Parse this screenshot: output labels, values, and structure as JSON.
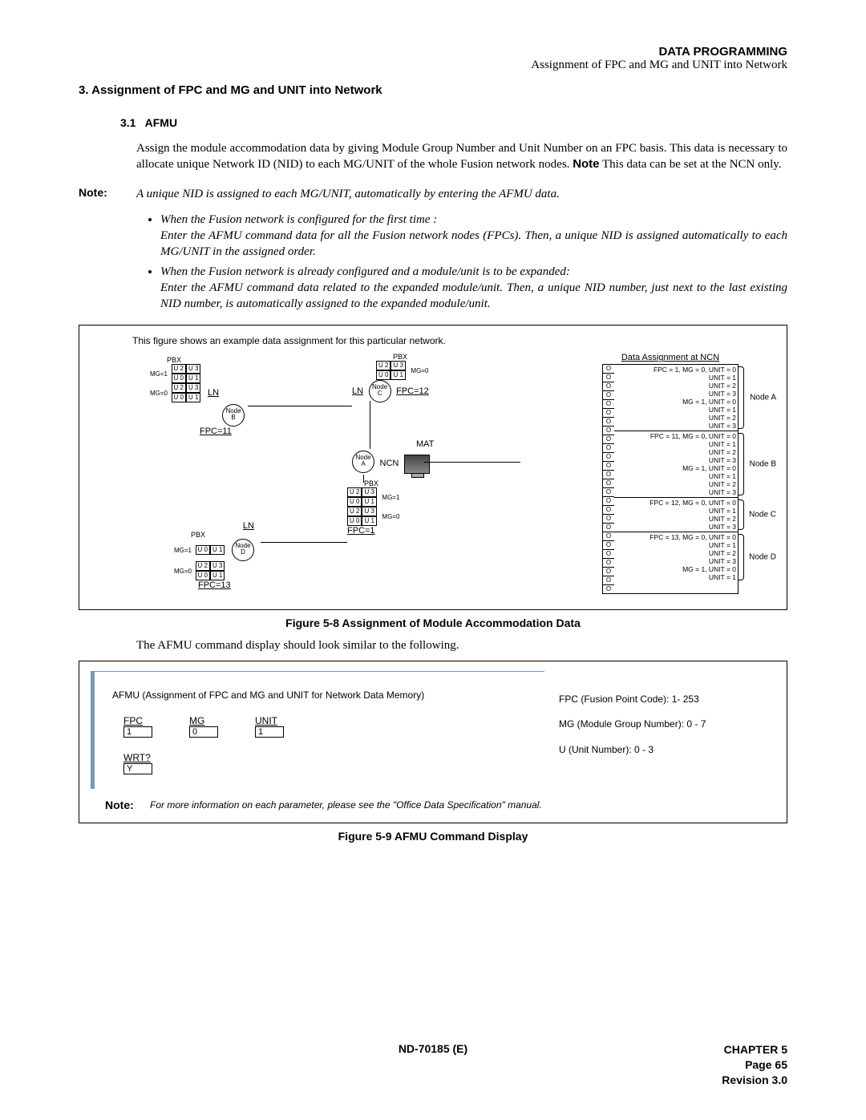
{
  "header": {
    "title": "DATA PROGRAMMING",
    "subtitle": "Assignment of FPC and MG and UNIT into Network"
  },
  "section": {
    "num_title": "3.   Assignment of FPC and MG and UNIT into Network",
    "sub_num": "3.1",
    "sub_title": "AFMU",
    "para1_a": "Assign the module accommodation data by giving Module Group Number and Unit Number on an FPC basis. This data is necessary to allocate unique Network ID (NID) to each MG/UNIT of the whole Fusion network nodes. ",
    "para1_note_lbl": "Note",
    "para1_b": " This data can be set at the NCN only."
  },
  "note1": {
    "label": "Note:",
    "text": "A unique NID is assigned to each MG/UNIT, automatically by entering the AFMU data."
  },
  "bullets": {
    "b1": "When the Fusion network is configured for the first time :",
    "b1b": "Enter the AFMU command data for all the Fusion network nodes (FPCs). Then, a unique NID is assigned automatically to each MG/UNIT in the assigned order.",
    "b2": "When the Fusion network is already configured and a module/unit is to be expanded:",
    "b2b": "Enter the AFMU command data related to the expanded module/unit. Then, a unique NID number, just next to the last existing NID number, is automatically assigned to the expanded module/unit."
  },
  "fig58": {
    "intro": "This figure shows an example data assignment for this particular network.",
    "PBX": "PBX",
    "LN": "LN",
    "MG1": "MG=1",
    "MG0": "MG=0",
    "cells": {
      "u0": "U 0",
      "u1": "U 1",
      "u2": "U 2",
      "u3": "U 3"
    },
    "fpc11": "FPC=11",
    "fpc12": "FPC=12",
    "fpc13": "FPC=13",
    "fpc1": "FPC=1",
    "nodeA_top": "Node",
    "nodeA_bot": "A",
    "nodeB_top": "Node",
    "nodeB_bot": "B",
    "nodeC_top": "Node",
    "nodeC_bot": "C",
    "nodeD_top": "Node",
    "nodeD_bot": "D",
    "NCN": "NCN",
    "MAT": "MAT",
    "da_title": "Data Assignment at NCN",
    "marker": "O",
    "blocks": [
      {
        "node": "Node A",
        "lines": [
          "FPC = 1,   MG = 0, UNIT = 0",
          "UNIT = 1",
          "UNIT = 2",
          "UNIT = 3",
          "MG = 1, UNIT = 0",
          "UNIT = 1",
          "UNIT = 2",
          "UNIT = 3"
        ]
      },
      {
        "node": "Node B",
        "lines": [
          "FPC = 11,  MG = 0, UNIT = 0",
          "UNIT = 1",
          "UNIT = 2",
          "UNIT = 3",
          "MG = 1, UNIT = 0",
          "UNIT = 1",
          "UNIT = 2",
          "UNIT = 3"
        ]
      },
      {
        "node": "Node C",
        "lines": [
          "FPC = 12,  MG = 0, UNIT = 0",
          "UNIT = 1",
          "UNIT = 2",
          "UNIT = 3"
        ]
      },
      {
        "node": "Node D",
        "lines": [
          "FPC = 13,  MG = 0, UNIT = 0",
          "UNIT = 1",
          "UNIT = 2",
          "UNIT = 3",
          "MG = 1, UNIT = 0",
          "UNIT = 1"
        ]
      }
    ],
    "caption": "Figure 5-8   Assignment of Module Accommodation Data"
  },
  "post_fig_text": "The AFMU command display should look similar to the following.",
  "fig59": {
    "title": "AFMU (Assignment of FPC and MG and UNIT for Network Data Memory)",
    "fields": {
      "fpc_l": "FPC",
      "fpc_v": "1",
      "mg_l": "MG",
      "mg_v": "0",
      "unit_l": "UNIT",
      "unit_v": "1",
      "wrt_l": "WRT?",
      "wrt_v": "Y"
    },
    "right": {
      "r1": "FPC (Fusion Point Code): 1- 253",
      "r2": "MG (Module Group Number): 0 - 7",
      "r3": "U (Unit Number): 0 - 3"
    },
    "note_label": "Note:",
    "note_text": "For more information on each parameter, please see the \"Office Data Specification\" manual.",
    "caption": "Figure 5-9   AFMU Command Display"
  },
  "footer": {
    "center": "ND-70185 (E)",
    "r1": "CHAPTER 5",
    "r2": "Page 65",
    "r3": "Revision 3.0"
  }
}
